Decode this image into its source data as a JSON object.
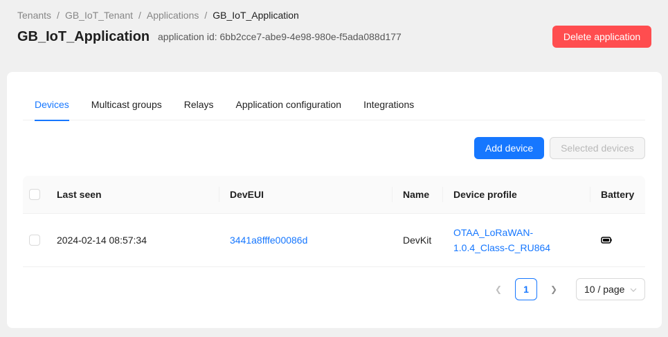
{
  "breadcrumb": {
    "items": [
      "Tenants",
      "GB_IoT_Tenant",
      "Applications",
      "GB_IoT_Application"
    ],
    "separator": "/"
  },
  "header": {
    "title": "GB_IoT_Application",
    "application_id_label": "application id: 6bb2cce7-abe9-4e98-980e-f5ada088d177",
    "delete_button": "Delete application"
  },
  "tabs": [
    {
      "label": "Devices",
      "active": true
    },
    {
      "label": "Multicast groups",
      "active": false
    },
    {
      "label": "Relays",
      "active": false
    },
    {
      "label": "Application configuration",
      "active": false
    },
    {
      "label": "Integrations",
      "active": false
    }
  ],
  "toolbar": {
    "add_device": "Add device",
    "selected_devices": "Selected devices"
  },
  "table": {
    "columns": [
      "Last seen",
      "DevEUI",
      "Name",
      "Device profile",
      "Battery"
    ],
    "rows": [
      {
        "last_seen": "2024-02-14 08:57:34",
        "dev_eui": "3441a8fffe00086d",
        "name": "DevKit",
        "device_profile_line1": "OTAA_LoRaWAN-",
        "device_profile_line2": "1.0.4_Class-C_RU864",
        "battery_icon": "battery-icon"
      }
    ]
  },
  "pagination": {
    "current_page": "1",
    "page_size": "10 / page",
    "prev_icon": "chevron-left-icon",
    "next_icon": "chevron-right-icon"
  },
  "colors": {
    "primary": "#1677ff",
    "danger": "#ff4d4f",
    "background": "#f0f0f0"
  }
}
